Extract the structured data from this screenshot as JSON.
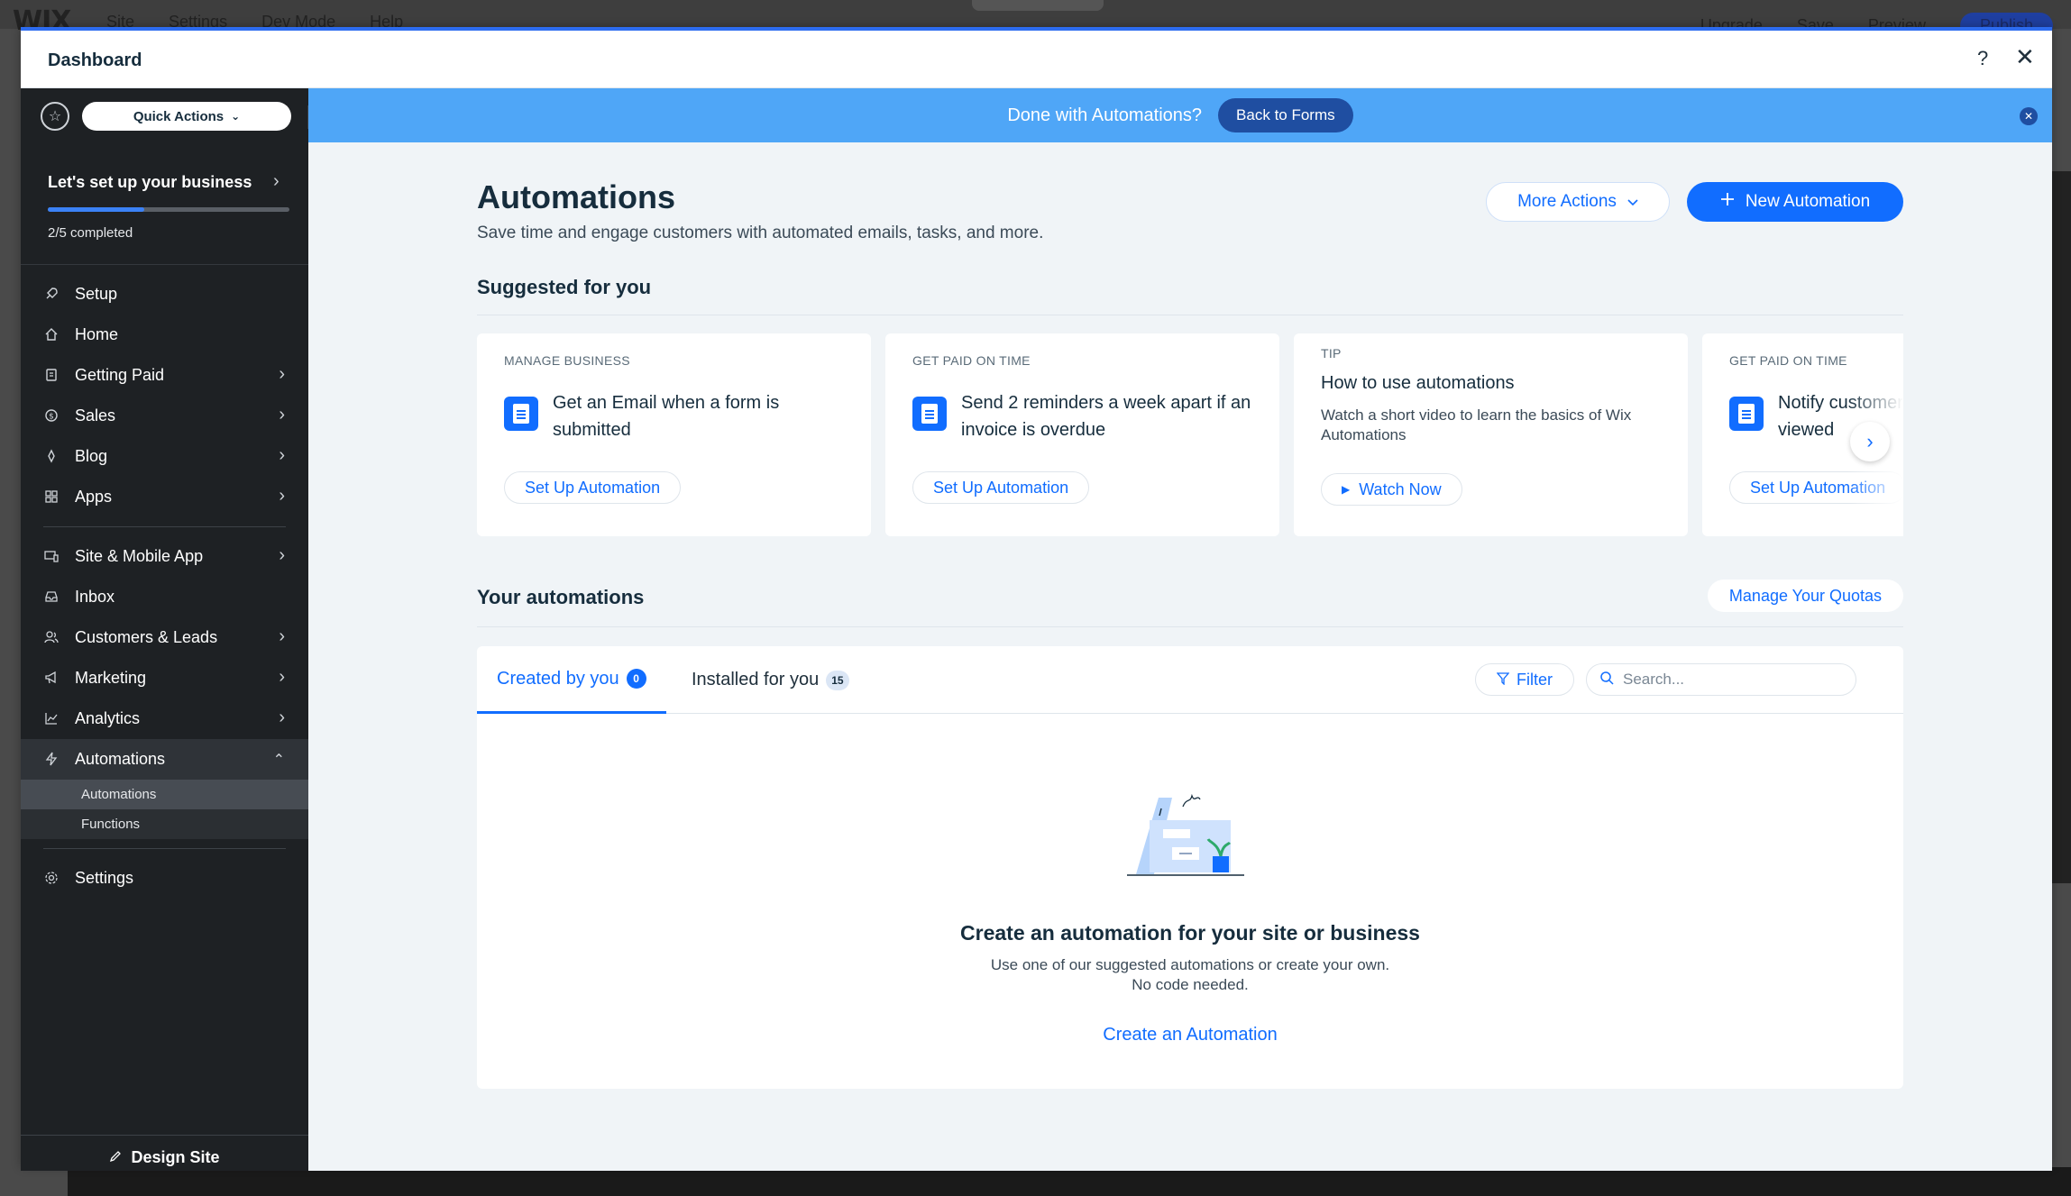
{
  "editor": {
    "logo": "WIX",
    "menu": [
      "Site",
      "Settings",
      "Dev Mode",
      "Help"
    ],
    "right": {
      "upgrade": "Upgrade",
      "save": "Save",
      "preview": "Preview",
      "publish": "Publish"
    }
  },
  "modal": {
    "title": "Dashboard",
    "help": "?",
    "close": "✕"
  },
  "sidebar": {
    "quick_actions": "Quick Actions",
    "setup": {
      "title": "Let's set up your business",
      "progress_text": "2/5 completed",
      "progress_fraction": 0.4
    },
    "items": [
      {
        "label": "Setup",
        "icon": "rocket-icon",
        "chevron": false
      },
      {
        "label": "Home",
        "icon": "home-icon",
        "chevron": false
      },
      {
        "label": "Getting Paid",
        "icon": "payment-icon",
        "chevron": true
      },
      {
        "label": "Sales",
        "icon": "dollar-icon",
        "chevron": true
      },
      {
        "label": "Blog",
        "icon": "pen-icon",
        "chevron": true
      },
      {
        "label": "Apps",
        "icon": "apps-icon",
        "chevron": true
      }
    ],
    "items2": [
      {
        "label": "Site & Mobile App",
        "icon": "devices-icon",
        "chevron": true
      },
      {
        "label": "Inbox",
        "icon": "inbox-icon",
        "chevron": false
      },
      {
        "label": "Customers & Leads",
        "icon": "people-icon",
        "chevron": true
      },
      {
        "label": "Marketing",
        "icon": "megaphone-icon",
        "chevron": true
      },
      {
        "label": "Analytics",
        "icon": "chart-icon",
        "chevron": true
      }
    ],
    "automations": {
      "label": "Automations",
      "icon": "bolt-icon",
      "sub": [
        "Automations",
        "Functions"
      ]
    },
    "settings": {
      "label": "Settings",
      "icon": "gear-icon"
    },
    "design_site": "Design Site"
  },
  "banner": {
    "text": "Done with Automations?",
    "button": "Back to Forms"
  },
  "page": {
    "title": "Automations",
    "subtitle": "Save time and engage customers with automated emails, tasks, and more.",
    "more_actions": "More Actions",
    "new_automation": "New Automation"
  },
  "suggested": {
    "title": "Suggested for you",
    "cards": [
      {
        "eyebrow": "MANAGE BUSINESS",
        "text": "Get an Email when a form is submitted",
        "button": "Set Up Automation"
      },
      {
        "eyebrow": "GET PAID ON TIME",
        "text": "Send 2 reminders a week apart if an invoice is overdue",
        "button": "Set Up Automation"
      },
      {
        "eyebrow": "TIP",
        "title": "How to use automations",
        "desc": "Watch a short video to learn the basics of Wix Automations",
        "button": "Watch Now"
      },
      {
        "eyebrow": "GET PAID ON TIME",
        "text": "Notify customers when invoice viewed",
        "button": "Set Up Automation"
      }
    ]
  },
  "yours": {
    "title": "Your automations",
    "manage_quotas": "Manage Your Quotas",
    "tabs": [
      {
        "label": "Created by you",
        "count": "0"
      },
      {
        "label": "Installed for you",
        "count": "15"
      }
    ],
    "filter": "Filter",
    "search_placeholder": "Search...",
    "empty": {
      "title": "Create an automation for your site or business",
      "desc_line1": "Use one of our suggested automations or create your own.",
      "desc_line2": "No code needed.",
      "link": "Create an Automation"
    }
  }
}
